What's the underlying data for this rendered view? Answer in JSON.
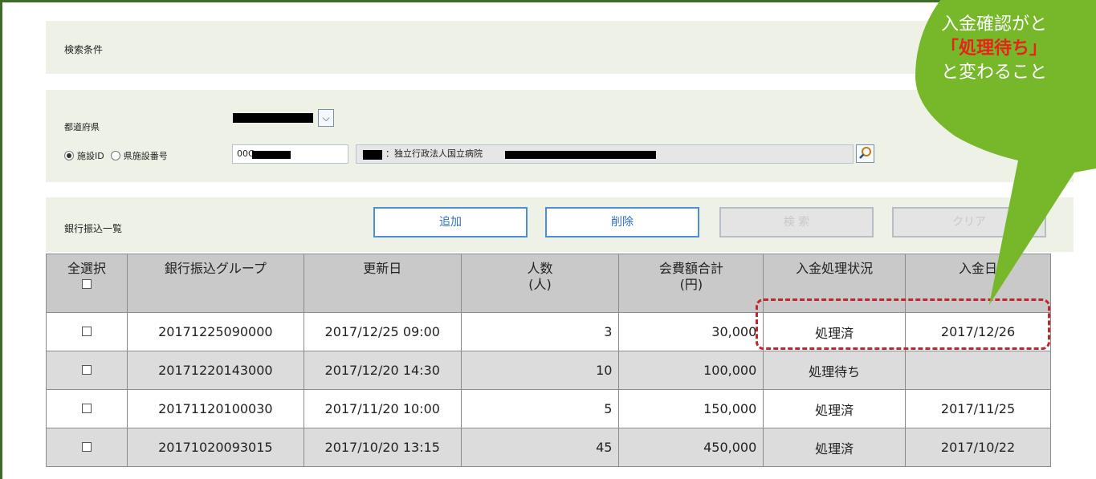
{
  "search": {
    "title": "検索条件",
    "prefecture_label": "都道府県",
    "radio_facility_id": "施設ID",
    "radio_pref_number": "県施設番号",
    "id_value": "00C",
    "facility_name_fragment": "：独立行政法人国立病院"
  },
  "bank": {
    "title": "銀行振込一覧",
    "buttons": {
      "add": "追加",
      "delete": "削除",
      "search": "検 索",
      "clear": "クリア"
    }
  },
  "table": {
    "headers": {
      "select_all": "全選択",
      "group": "銀行振込グループ",
      "updated": "更新日",
      "people": "人数",
      "people_unit": "(人)",
      "fee_total": "会費額合計",
      "fee_unit": "(円)",
      "status": "入金処理状況",
      "paid_date": "入金日"
    },
    "rows": [
      {
        "group": "20171225090000",
        "updated": "2017/12/25 09:00",
        "people": "3",
        "fee": "30,000",
        "status": "処理済",
        "paid": "2017/12/26"
      },
      {
        "group": "20171220143000",
        "updated": "2017/12/20 14:30",
        "people": "10",
        "fee": "100,000",
        "status": "処理待ち",
        "paid": ""
      },
      {
        "group": "20171120100030",
        "updated": "2017/11/20 10:00",
        "people": "5",
        "fee": "150,000",
        "status": "処理済",
        "paid": "2017/11/25"
      },
      {
        "group": "20171020093015",
        "updated": "2017/10/20 13:15",
        "people": "45",
        "fee": "450,000",
        "status": "処理済",
        "paid": "2017/10/22"
      }
    ]
  },
  "callout": {
    "line1": "入金確認がと",
    "line2": "「処理待ち」",
    "line3": "と変わること",
    "bubble_color": "#76b82a",
    "emphasis_color": "#e8231b"
  },
  "colors": {
    "frame": "#3c6e2a",
    "button_border": "#4a90d9",
    "highlight": "#c0262c"
  }
}
